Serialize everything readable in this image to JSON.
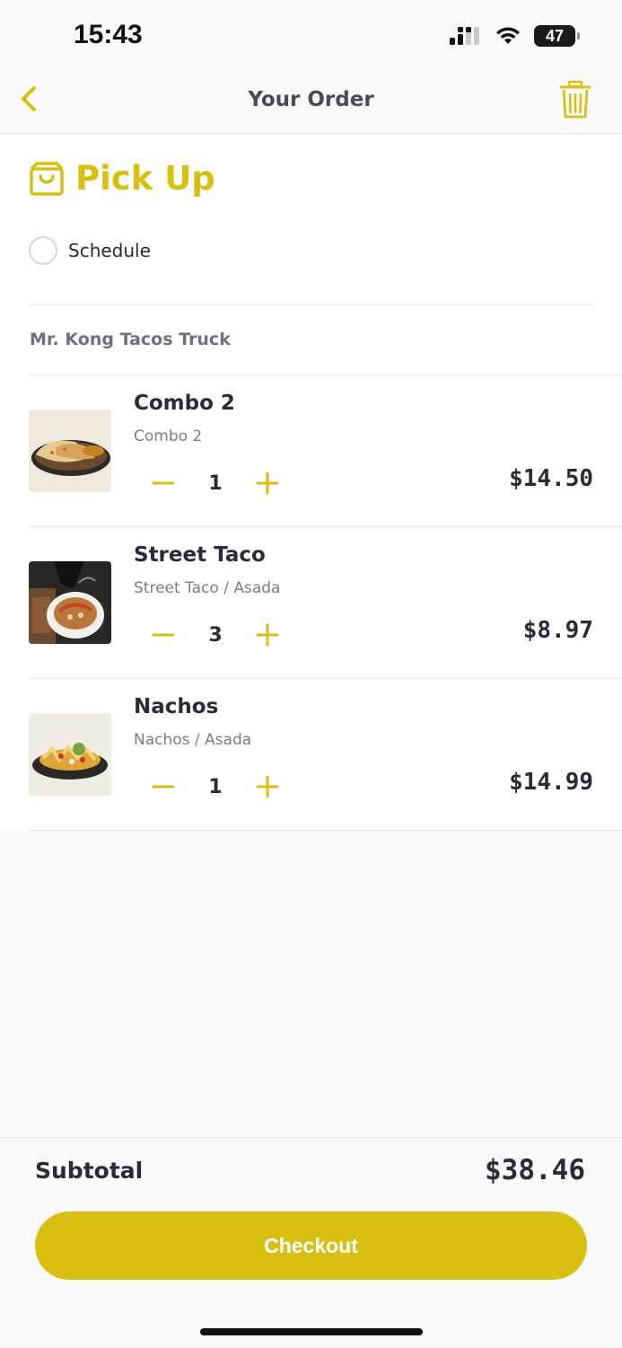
{
  "status_bar": {
    "time": "15:43",
    "battery": "47",
    "icons": [
      "cellular-signal-icon",
      "wifi-icon",
      "battery-icon"
    ]
  },
  "nav": {
    "title": "Your Order",
    "back_icon": "chevron-left-icon",
    "trash_icon": "trash-icon"
  },
  "order": {
    "mode_title": "Pick Up",
    "mode_icon": "shopping-bag-icon",
    "schedule_label": "Schedule",
    "vendor": "Mr. Kong Tacos Truck"
  },
  "items": [
    {
      "name": "Combo 2",
      "description": "Combo 2",
      "quantity": "1",
      "price": "$14.50",
      "image": "quesadilla-plate-photo"
    },
    {
      "name": "Street Taco",
      "description": "Street Taco / Asada",
      "quantity": "3",
      "price": "$8.97",
      "image": "street-taco-photo"
    },
    {
      "name": "Nachos",
      "description": "Nachos / Asada",
      "quantity": "1",
      "price": "$14.99",
      "image": "nachos-plate-photo"
    }
  ],
  "footer": {
    "subtotal_label": "Subtotal",
    "subtotal_value": "$38.46",
    "checkout_label": "Checkout"
  },
  "colors": {
    "accent": "#d8bf12",
    "text_dark": "#2c2a3a",
    "text_muted": "#7b7b90"
  }
}
